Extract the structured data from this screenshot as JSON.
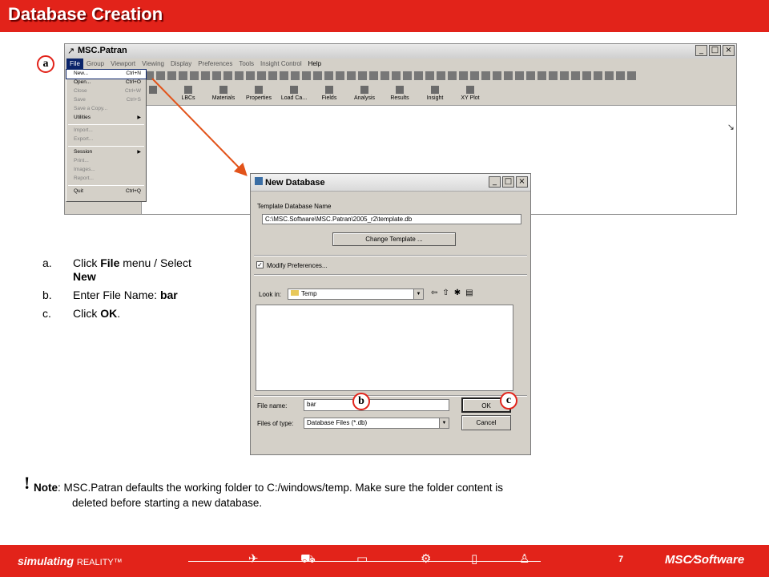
{
  "slide": {
    "title": "Database Creation",
    "page_number": "7",
    "footer_tag_main": "simulating",
    "footer_tag_small": "REALITY™",
    "footer_logo": "MSC∕Software"
  },
  "patran": {
    "window_title": "MSC.Patran",
    "menus": [
      "File",
      "Group",
      "Viewport",
      "Viewing",
      "Display",
      "Preferences",
      "Tools",
      "Insight Control",
      "Help"
    ],
    "apps": [
      "",
      "LBCs",
      "Materials",
      "Properties",
      "Load Ca...",
      "Fields",
      "Analysis",
      "Results",
      "Insight",
      "XY Plot"
    ],
    "file_menu": {
      "new": {
        "label": "New...",
        "shortcut": "Ctrl+N"
      },
      "open": {
        "label": "Open...",
        "shortcut": "Ctrl+O"
      },
      "close": {
        "label": "Close",
        "shortcut": "Ctrl+W"
      },
      "save": {
        "label": "Save",
        "shortcut": "Ctrl+S"
      },
      "save_copy": {
        "label": "Save a Copy..."
      },
      "utilities": {
        "label": "Utilities"
      },
      "import": {
        "label": "Import..."
      },
      "export": {
        "label": "Export..."
      },
      "session": {
        "label": "Session"
      },
      "print": {
        "label": "Print..."
      },
      "images": {
        "label": "Images..."
      },
      "report": {
        "label": "Report..."
      },
      "quit": {
        "label": "Quit",
        "shortcut": "Ctrl+Q"
      }
    }
  },
  "badges": {
    "a": "a",
    "b": "b",
    "c": "c"
  },
  "steps": [
    {
      "letter": "a.",
      "pre": "Click ",
      "bold1": "File",
      "mid": " menu / Select ",
      "bold2": "New"
    },
    {
      "letter": "b.",
      "pre": "Enter File Name: ",
      "bold1": "bar"
    },
    {
      "letter": "c.",
      "pre": "Click ",
      "bold1": "OK",
      "post": "."
    }
  ],
  "dialog": {
    "title": "New Database",
    "template_label": "Template Database Name",
    "template_value": "C:\\MSC.Software\\MSC.Patran\\2005_r2\\template.db",
    "change_template": "Change Template ...",
    "modify_prefs": "Modify Preferences...",
    "look_in_label": "Look in:",
    "look_in_value": "Temp",
    "file_name_label": "File name:",
    "file_name_value": "bar",
    "files_type_label": "Files of type:",
    "files_type_value": "Database Files (*.db)",
    "ok": "OK",
    "cancel": "Cancel"
  },
  "note": {
    "mark": "!",
    "label": "Note",
    "line1": ": MSC.Patran defaults the working folder to C:/windows/temp. Make sure the folder content is",
    "line2": "deleted before starting a new database."
  },
  "colors": {
    "accent_red": "#e2231a",
    "menu_highlight": "#0a246a"
  }
}
